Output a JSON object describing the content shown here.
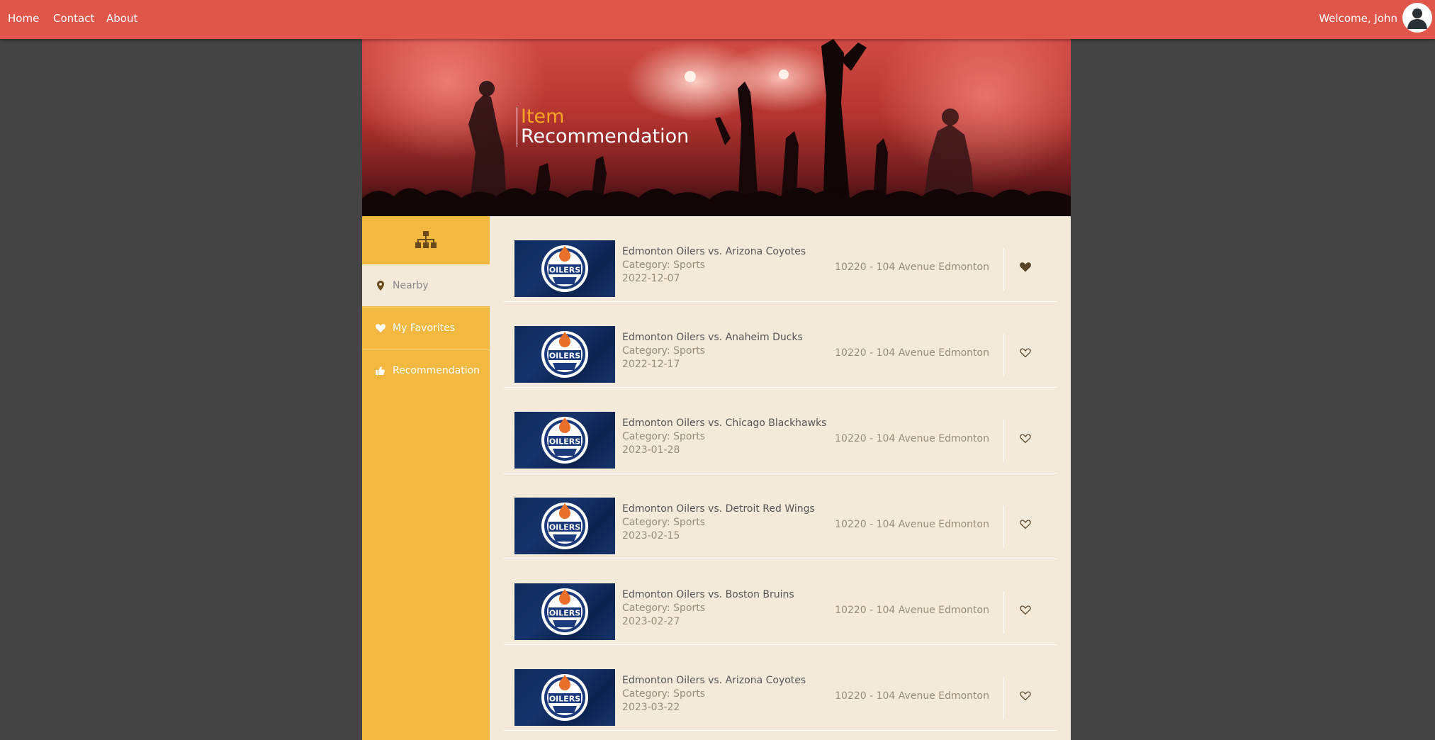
{
  "nav": {
    "links": [
      "Home",
      "Contact",
      "About"
    ],
    "welcome": "Welcome, John"
  },
  "banner": {
    "title_line1": "Item",
    "title_line2": "Recommendation"
  },
  "sidebar": {
    "header_icon": "sitemap-icon",
    "items": [
      {
        "label": "Nearby",
        "icon": "map-marker-icon",
        "active": true
      },
      {
        "label": "My Favorites",
        "icon": "heart-icon",
        "active": false
      },
      {
        "label": "Recommendation",
        "icon": "thumbs-up-icon",
        "active": false
      }
    ]
  },
  "items": [
    {
      "title": "Edmonton Oilers vs. Arizona Coyotes",
      "category": "Category: Sports",
      "date": "2022-12-07",
      "address": "10220 - 104 Avenue Edmonton",
      "favorited": true
    },
    {
      "title": "Edmonton Oilers vs. Anaheim Ducks",
      "category": "Category: Sports",
      "date": "2022-12-17",
      "address": "10220 - 104 Avenue Edmonton",
      "favorited": false
    },
    {
      "title": "Edmonton Oilers vs. Chicago Blackhawks",
      "category": "Category: Sports",
      "date": "2023-01-28",
      "address": "10220 - 104 Avenue Edmonton",
      "favorited": false
    },
    {
      "title": "Edmonton Oilers vs. Detroit Red Wings",
      "category": "Category: Sports",
      "date": "2023-02-15",
      "address": "10220 - 104 Avenue Edmonton",
      "favorited": false
    },
    {
      "title": "Edmonton Oilers vs. Boston Bruins",
      "category": "Category: Sports",
      "date": "2023-02-27",
      "address": "10220 - 104 Avenue Edmonton",
      "favorited": false
    },
    {
      "title": "Edmonton Oilers vs. Arizona Coyotes",
      "category": "Category: Sports",
      "date": "2023-03-22",
      "address": "10220 - 104 Avenue Edmonton",
      "favorited": false
    }
  ],
  "thumbnail_logo_text": "OILERS",
  "colors": {
    "navbar": "#e0564a",
    "sidebar": "#f2b840",
    "content_bg": "#f3ead9",
    "page_bg": "#444444",
    "title_accent": "#f5a623"
  }
}
